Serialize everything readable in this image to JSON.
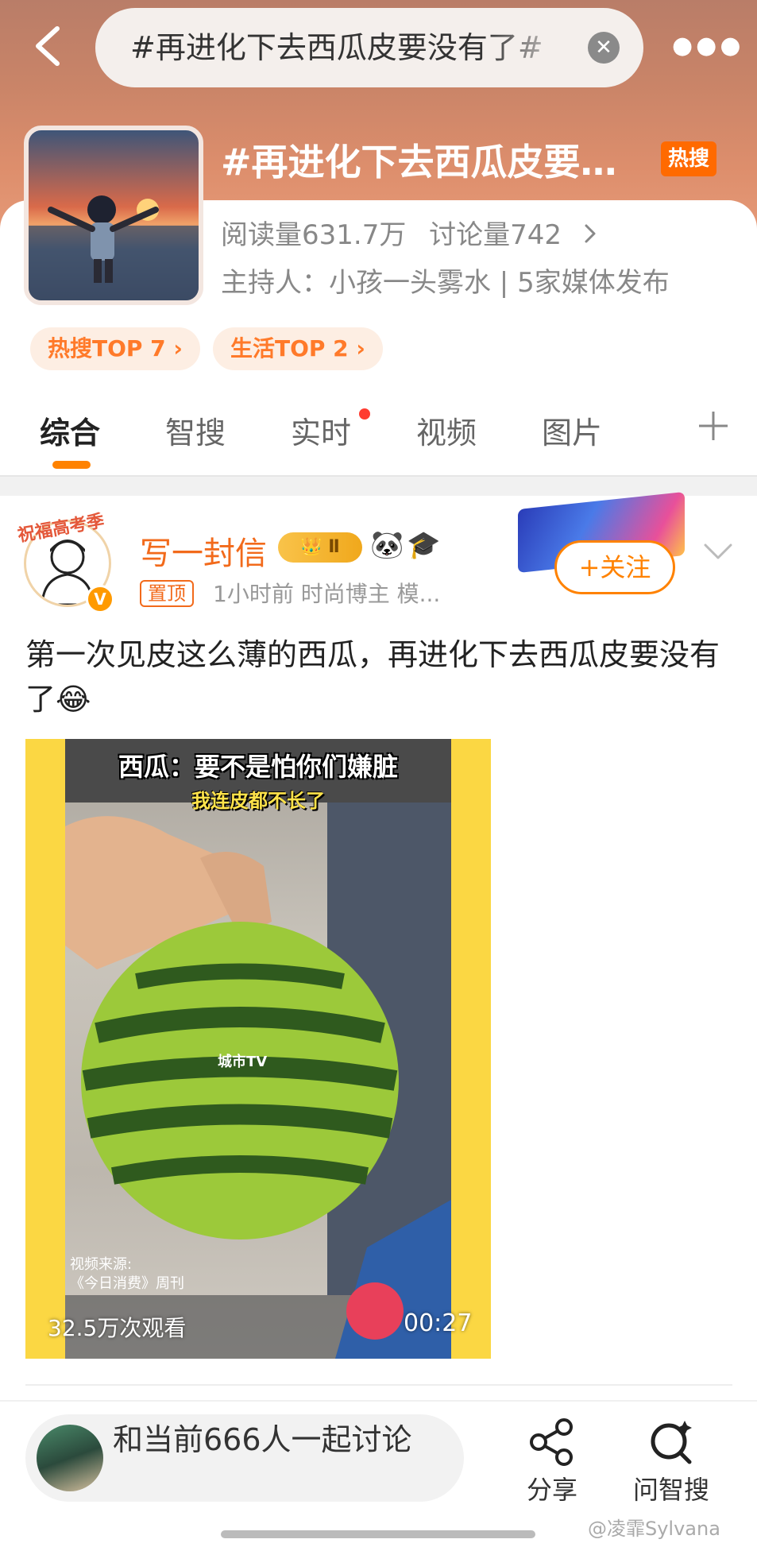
{
  "header": {
    "search_query": "#再进化下去西瓜皮要没有了#",
    "topic_title": "#再进化下去西瓜皮要没有了#",
    "hot_badge": "热搜"
  },
  "topic_card": {
    "stats": {
      "read_count": "阅读量631.7万",
      "discuss_count": "讨论量742"
    },
    "host_line": "主持人：小孩一头雾水 | 5家媒体发布",
    "pills": [
      {
        "label": "热搜TOP 7 ›"
      },
      {
        "label": "生活TOP 2 ›"
      }
    ]
  },
  "tabs": [
    {
      "label": "综合",
      "active": true
    },
    {
      "label": "智搜",
      "active": false
    },
    {
      "label": "实时",
      "active": false
    },
    {
      "label": "视频",
      "active": false
    },
    {
      "label": "图片",
      "active": false
    }
  ],
  "post": {
    "author": "写一封信",
    "avatar_ribbon": "祝福高考季",
    "vip_level": "Ⅱ",
    "emojis": [
      "🐼",
      "🎓"
    ],
    "pinned_label": "置顶",
    "meta": "1小时前  时尚博主 模...",
    "follow_label": "+关注",
    "text": "第一次见皮这么薄的西瓜，再进化下去西瓜皮要没有了😂",
    "video": {
      "caption_main": "西瓜：要不是怕你们嫌脏",
      "caption_sub": "我连皮都不长了",
      "channel_logo": "城市TV",
      "source_line1": "视频来源:",
      "source_line2": "《今日消费》周刊",
      "views": "32.5万次观看",
      "duration": "00:27"
    }
  },
  "bottom_bar": {
    "discuss_text": "和当前666人一起讨论",
    "share_label": "分享",
    "ask_label": "问智搜"
  },
  "credit": "@凌霏Sylvana",
  "colors": {
    "accent": "#ff8200",
    "username": "#f26a1b",
    "hot_badge": "#ff6a00",
    "red_dot": "#ff3b30"
  }
}
